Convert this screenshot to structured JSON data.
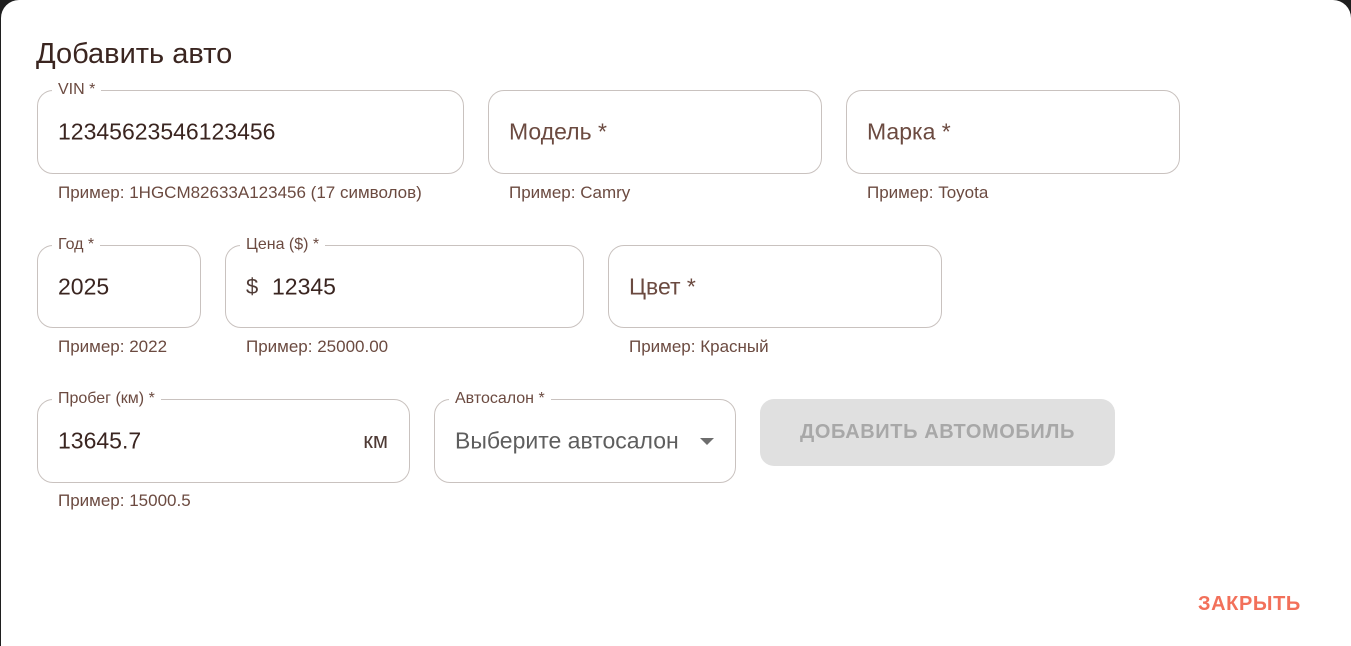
{
  "dialog": {
    "title": "Добавить авто"
  },
  "fields": {
    "vin": {
      "label": "VIN *",
      "value": "12345623546123456",
      "helper": "Пример: 1HGCM82633A123456 (17 символов)"
    },
    "model": {
      "placeholder": "Модель *",
      "helper": "Пример: Camry"
    },
    "brand": {
      "placeholder": "Марка *",
      "helper": "Пример: Toyota"
    },
    "year": {
      "label": "Год *",
      "value": "2025",
      "helper": "Пример: 2022"
    },
    "price": {
      "label": "Цена ($) *",
      "prefix": "$",
      "value": "12345",
      "helper": "Пример: 25000.00"
    },
    "color": {
      "placeholder": "Цвет *",
      "helper": "Пример: Красный"
    },
    "mileage": {
      "label": "Пробег (км) *",
      "value": "13645.7",
      "suffix": "км",
      "helper": "Пример: 15000.5"
    },
    "dealership": {
      "label": "Автосалон *",
      "selected": "Выберите автосалон",
      "icon": "chevron-down-icon"
    }
  },
  "actions": {
    "add_label": "ДОБАВИТЬ АВТОМОБИЛЬ",
    "add_disabled": true,
    "close_label": "ЗАКРЫТЬ"
  },
  "colors": {
    "text": "#3a2520",
    "secondary_text": "#6b4a40",
    "border": "#c9c2bf",
    "disabled_bg": "#e0e0e0",
    "disabled_text": "#a8a8a8",
    "accent": "#f2705a"
  }
}
